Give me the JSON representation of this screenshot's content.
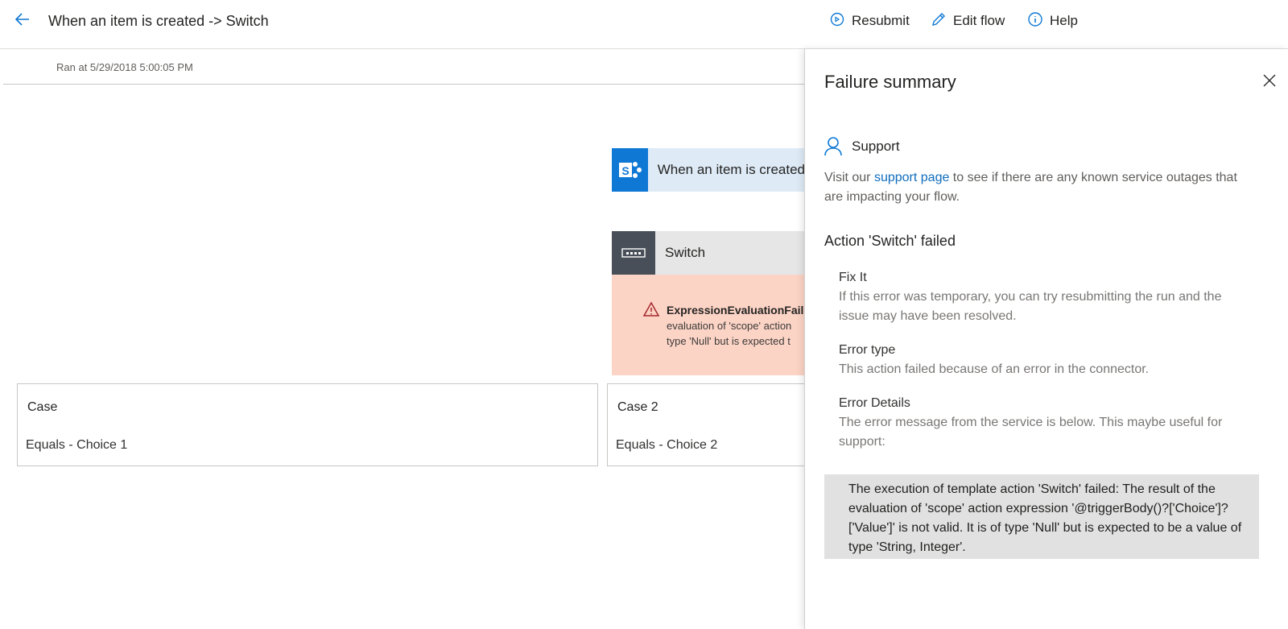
{
  "header": {
    "title": "When an item is created -> Switch",
    "resubmit_label": "Resubmit",
    "edit_flow_label": "Edit flow",
    "help_label": "Help"
  },
  "run": {
    "ran_at": "Ran at 5/29/2018 5:00:05 PM"
  },
  "canvas": {
    "trigger_label": "When an item is created",
    "switch_label": "Switch",
    "error": {
      "title": "ExpressionEvaluationFaile",
      "line1": "evaluation of 'scope' action",
      "line2": "type 'Null' but is expected t"
    },
    "cases": [
      {
        "title": "Case",
        "condition": "Equals - Choice 1"
      },
      {
        "title": "Case 2",
        "condition": "Equals - Choice 2"
      }
    ]
  },
  "panel": {
    "title": "Failure summary",
    "support_label": "Support",
    "support_text_before": "Visit our ",
    "support_link": "support page",
    "support_text_after": " to see if there are any known service outages that are impacting your flow.",
    "action_failed": "Action 'Switch' failed",
    "fix_it_title": "Fix It",
    "fix_it_text": "If this error was temporary, you can try resubmitting the run and the issue may have been resolved.",
    "error_type_title": "Error type",
    "error_type_text": "This action failed because of an error in the connector.",
    "error_details_title": "Error Details",
    "error_details_text": "The error message from the service is below. This maybe useful for support:",
    "error_message": "The execution of template action 'Switch' failed: The result of the evaluation of 'scope' action expression '@triggerBody()?['Choice']?['Value']' is not valid. It is of type 'Null' but is expected to be a value of type 'String, Integer'."
  },
  "colors": {
    "accent": "#0f78d4",
    "error_bg": "#fcd4c6",
    "warning_icon": "#a4262c"
  },
  "icons": {
    "back": "arrow-left-icon",
    "resubmit": "resubmit-icon",
    "edit": "pencil-icon",
    "help": "info-icon",
    "close": "close-icon",
    "support": "person-icon",
    "warning": "warning-icon",
    "sharepoint": "sharepoint-icon",
    "switch": "switch-icon"
  }
}
